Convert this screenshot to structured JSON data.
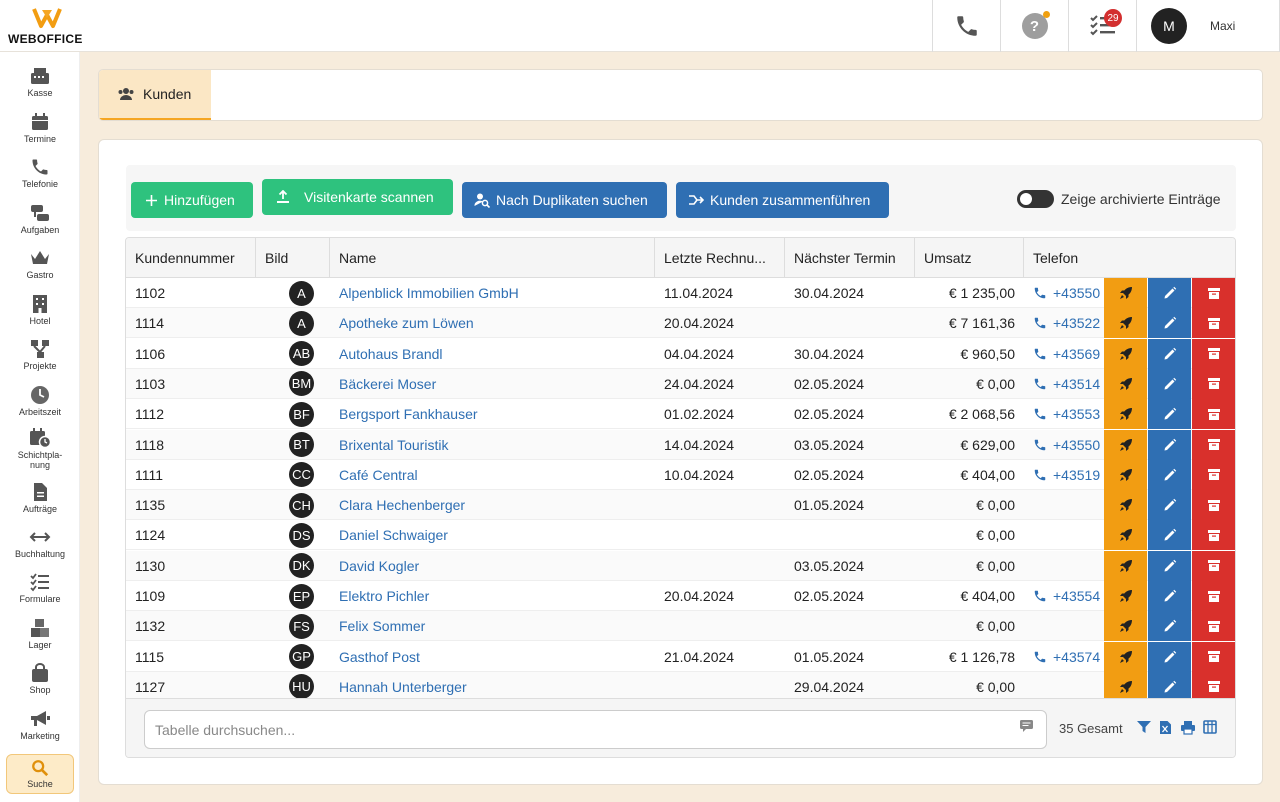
{
  "app": {
    "logo_text": "WEBOFFICE"
  },
  "topbar": {
    "tasks_badge": "29",
    "help_glyph": "?",
    "user_initial": "M",
    "user_name": "Maxi"
  },
  "sidebar": {
    "items": [
      {
        "label": "Kasse",
        "icon": "cash-register-icon"
      },
      {
        "label": "Termine",
        "icon": "calendar-icon"
      },
      {
        "label": "Telefonie",
        "icon": "phone-icon"
      },
      {
        "label": "Aufgaben",
        "icon": "tasks-icon"
      },
      {
        "label": "Gastro",
        "icon": "crown-icon"
      },
      {
        "label": "Hotel",
        "icon": "building-icon"
      },
      {
        "label": "Projekte",
        "icon": "sitemap-icon"
      },
      {
        "label": "Arbeitszeit",
        "icon": "clock-icon"
      },
      {
        "label": "Schichtpla-\nnung",
        "icon": "calendar-clock-icon"
      },
      {
        "label": "Aufträge",
        "icon": "document-icon"
      },
      {
        "label": "Buchhaltung",
        "icon": "arrows-icon"
      },
      {
        "label": "Formulare",
        "icon": "checklist-icon"
      },
      {
        "label": "Lager",
        "icon": "boxes-icon"
      },
      {
        "label": "Shop",
        "icon": "bag-icon"
      },
      {
        "label": "Marketing",
        "icon": "megaphone-icon"
      },
      {
        "label": "Suche",
        "icon": "search-icon"
      }
    ]
  },
  "tabs": [
    {
      "label": "Kunden",
      "icon": "users-icon",
      "active": true
    }
  ],
  "toolbar": {
    "add_label": "Hinzufügen",
    "scan_label": "Visitenkarte scannen",
    "duplicates_label": "Nach Duplikaten suchen",
    "merge_label": "Kunden zusammenführen",
    "archived_label": "Zeige archivierte Einträge",
    "archived_on": false
  },
  "table": {
    "columns": [
      "Kundennummer",
      "Bild",
      "Name",
      "Letzte Rechnu...",
      "Nächster Termin",
      "Umsatz",
      "Telefon"
    ],
    "rows": [
      {
        "nr": "1102",
        "initials": "A",
        "name": "Alpenblick Immobilien GmbH",
        "last_invoice": "11.04.2024",
        "next_appt": "30.04.2024",
        "revenue": "€ 1 235,00",
        "phone": "+43550"
      },
      {
        "nr": "1114",
        "initials": "A",
        "name": "Apotheke zum Löwen",
        "last_invoice": "20.04.2024",
        "next_appt": "",
        "revenue": "€ 7 161,36",
        "phone": "+43522"
      },
      {
        "nr": "1106",
        "initials": "AB",
        "name": "Autohaus Brandl",
        "last_invoice": "04.04.2024",
        "next_appt": "30.04.2024",
        "revenue": "€ 960,50",
        "phone": "+43569"
      },
      {
        "nr": "1103",
        "initials": "BM",
        "name": "Bäckerei Moser",
        "last_invoice": "24.04.2024",
        "next_appt": "02.05.2024",
        "revenue": "€ 0,00",
        "phone": "+43514"
      },
      {
        "nr": "1112",
        "initials": "BF",
        "name": "Bergsport Fankhauser",
        "last_invoice": "01.02.2024",
        "next_appt": "02.05.2024",
        "revenue": "€ 2 068,56",
        "phone": "+43553"
      },
      {
        "nr": "1118",
        "initials": "BT",
        "name": "Brixental Touristik",
        "last_invoice": "14.04.2024",
        "next_appt": "03.05.2024",
        "revenue": "€ 629,00",
        "phone": "+43550"
      },
      {
        "nr": "1111",
        "initials": "CC",
        "name": "Café Central",
        "last_invoice": "10.04.2024",
        "next_appt": "02.05.2024",
        "revenue": "€ 404,00",
        "phone": "+43519"
      },
      {
        "nr": "1135",
        "initials": "CH",
        "name": "Clara Hechenberger",
        "last_invoice": "",
        "next_appt": "01.05.2024",
        "revenue": "€ 0,00",
        "phone": ""
      },
      {
        "nr": "1124",
        "initials": "DS",
        "name": "Daniel Schwaiger",
        "last_invoice": "",
        "next_appt": "",
        "revenue": "€ 0,00",
        "phone": ""
      },
      {
        "nr": "1130",
        "initials": "DK",
        "name": "David Kogler",
        "last_invoice": "",
        "next_appt": "03.05.2024",
        "revenue": "€ 0,00",
        "phone": ""
      },
      {
        "nr": "1109",
        "initials": "EP",
        "name": "Elektro Pichler",
        "last_invoice": "20.04.2024",
        "next_appt": "02.05.2024",
        "revenue": "€ 404,00",
        "phone": "+43554"
      },
      {
        "nr": "1132",
        "initials": "FS",
        "name": "Felix Sommer",
        "last_invoice": "",
        "next_appt": "",
        "revenue": "€ 0,00",
        "phone": ""
      },
      {
        "nr": "1115",
        "initials": "GP",
        "name": "Gasthof Post",
        "last_invoice": "21.04.2024",
        "next_appt": "01.05.2024",
        "revenue": "€ 1 126,78",
        "phone": "+43574"
      },
      {
        "nr": "1127",
        "initials": "HU",
        "name": "Hannah Unterberger",
        "last_invoice": "",
        "next_appt": "29.04.2024",
        "revenue": "€ 0,00",
        "phone": ""
      }
    ]
  },
  "footer": {
    "search_placeholder": "Tabelle durchsuchen...",
    "total": "35 Gesamt"
  },
  "colors": {
    "accent": "#f5a623",
    "green": "#2ec27e",
    "blue": "#2f6fb3",
    "orange": "#f29d12",
    "red": "#d9302c"
  }
}
